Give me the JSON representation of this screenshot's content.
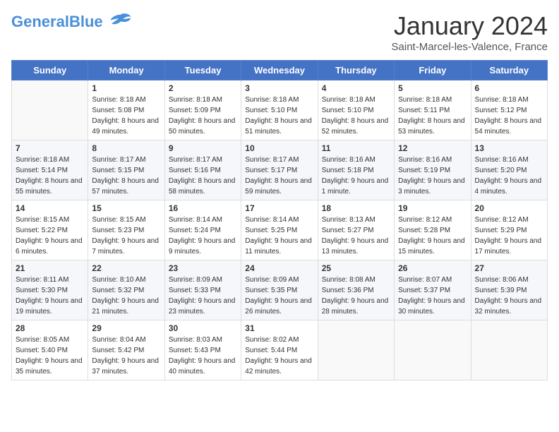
{
  "header": {
    "logo_line1": "General",
    "logo_line2": "Blue",
    "month_title": "January 2024",
    "location": "Saint-Marcel-les-Valence, France"
  },
  "weekdays": [
    "Sunday",
    "Monday",
    "Tuesday",
    "Wednesday",
    "Thursday",
    "Friday",
    "Saturday"
  ],
  "weeks": [
    [
      {
        "day": "",
        "sunrise": "",
        "sunset": "",
        "daylight": ""
      },
      {
        "day": "1",
        "sunrise": "Sunrise: 8:18 AM",
        "sunset": "Sunset: 5:08 PM",
        "daylight": "Daylight: 8 hours and 49 minutes."
      },
      {
        "day": "2",
        "sunrise": "Sunrise: 8:18 AM",
        "sunset": "Sunset: 5:09 PM",
        "daylight": "Daylight: 8 hours and 50 minutes."
      },
      {
        "day": "3",
        "sunrise": "Sunrise: 8:18 AM",
        "sunset": "Sunset: 5:10 PM",
        "daylight": "Daylight: 8 hours and 51 minutes."
      },
      {
        "day": "4",
        "sunrise": "Sunrise: 8:18 AM",
        "sunset": "Sunset: 5:10 PM",
        "daylight": "Daylight: 8 hours and 52 minutes."
      },
      {
        "day": "5",
        "sunrise": "Sunrise: 8:18 AM",
        "sunset": "Sunset: 5:11 PM",
        "daylight": "Daylight: 8 hours and 53 minutes."
      },
      {
        "day": "6",
        "sunrise": "Sunrise: 8:18 AM",
        "sunset": "Sunset: 5:12 PM",
        "daylight": "Daylight: 8 hours and 54 minutes."
      }
    ],
    [
      {
        "day": "7",
        "sunrise": "Sunrise: 8:18 AM",
        "sunset": "Sunset: 5:14 PM",
        "daylight": "Daylight: 8 hours and 55 minutes."
      },
      {
        "day": "8",
        "sunrise": "Sunrise: 8:17 AM",
        "sunset": "Sunset: 5:15 PM",
        "daylight": "Daylight: 8 hours and 57 minutes."
      },
      {
        "day": "9",
        "sunrise": "Sunrise: 8:17 AM",
        "sunset": "Sunset: 5:16 PM",
        "daylight": "Daylight: 8 hours and 58 minutes."
      },
      {
        "day": "10",
        "sunrise": "Sunrise: 8:17 AM",
        "sunset": "Sunset: 5:17 PM",
        "daylight": "Daylight: 8 hours and 59 minutes."
      },
      {
        "day": "11",
        "sunrise": "Sunrise: 8:16 AM",
        "sunset": "Sunset: 5:18 PM",
        "daylight": "Daylight: 9 hours and 1 minute."
      },
      {
        "day": "12",
        "sunrise": "Sunrise: 8:16 AM",
        "sunset": "Sunset: 5:19 PM",
        "daylight": "Daylight: 9 hours and 3 minutes."
      },
      {
        "day": "13",
        "sunrise": "Sunrise: 8:16 AM",
        "sunset": "Sunset: 5:20 PM",
        "daylight": "Daylight: 9 hours and 4 minutes."
      }
    ],
    [
      {
        "day": "14",
        "sunrise": "Sunrise: 8:15 AM",
        "sunset": "Sunset: 5:22 PM",
        "daylight": "Daylight: 9 hours and 6 minutes."
      },
      {
        "day": "15",
        "sunrise": "Sunrise: 8:15 AM",
        "sunset": "Sunset: 5:23 PM",
        "daylight": "Daylight: 9 hours and 7 minutes."
      },
      {
        "day": "16",
        "sunrise": "Sunrise: 8:14 AM",
        "sunset": "Sunset: 5:24 PM",
        "daylight": "Daylight: 9 hours and 9 minutes."
      },
      {
        "day": "17",
        "sunrise": "Sunrise: 8:14 AM",
        "sunset": "Sunset: 5:25 PM",
        "daylight": "Daylight: 9 hours and 11 minutes."
      },
      {
        "day": "18",
        "sunrise": "Sunrise: 8:13 AM",
        "sunset": "Sunset: 5:27 PM",
        "daylight": "Daylight: 9 hours and 13 minutes."
      },
      {
        "day": "19",
        "sunrise": "Sunrise: 8:12 AM",
        "sunset": "Sunset: 5:28 PM",
        "daylight": "Daylight: 9 hours and 15 minutes."
      },
      {
        "day": "20",
        "sunrise": "Sunrise: 8:12 AM",
        "sunset": "Sunset: 5:29 PM",
        "daylight": "Daylight: 9 hours and 17 minutes."
      }
    ],
    [
      {
        "day": "21",
        "sunrise": "Sunrise: 8:11 AM",
        "sunset": "Sunset: 5:30 PM",
        "daylight": "Daylight: 9 hours and 19 minutes."
      },
      {
        "day": "22",
        "sunrise": "Sunrise: 8:10 AM",
        "sunset": "Sunset: 5:32 PM",
        "daylight": "Daylight: 9 hours and 21 minutes."
      },
      {
        "day": "23",
        "sunrise": "Sunrise: 8:09 AM",
        "sunset": "Sunset: 5:33 PM",
        "daylight": "Daylight: 9 hours and 23 minutes."
      },
      {
        "day": "24",
        "sunrise": "Sunrise: 8:09 AM",
        "sunset": "Sunset: 5:35 PM",
        "daylight": "Daylight: 9 hours and 26 minutes."
      },
      {
        "day": "25",
        "sunrise": "Sunrise: 8:08 AM",
        "sunset": "Sunset: 5:36 PM",
        "daylight": "Daylight: 9 hours and 28 minutes."
      },
      {
        "day": "26",
        "sunrise": "Sunrise: 8:07 AM",
        "sunset": "Sunset: 5:37 PM",
        "daylight": "Daylight: 9 hours and 30 minutes."
      },
      {
        "day": "27",
        "sunrise": "Sunrise: 8:06 AM",
        "sunset": "Sunset: 5:39 PM",
        "daylight": "Daylight: 9 hours and 32 minutes."
      }
    ],
    [
      {
        "day": "28",
        "sunrise": "Sunrise: 8:05 AM",
        "sunset": "Sunset: 5:40 PM",
        "daylight": "Daylight: 9 hours and 35 minutes."
      },
      {
        "day": "29",
        "sunrise": "Sunrise: 8:04 AM",
        "sunset": "Sunset: 5:42 PM",
        "daylight": "Daylight: 9 hours and 37 minutes."
      },
      {
        "day": "30",
        "sunrise": "Sunrise: 8:03 AM",
        "sunset": "Sunset: 5:43 PM",
        "daylight": "Daylight: 9 hours and 40 minutes."
      },
      {
        "day": "31",
        "sunrise": "Sunrise: 8:02 AM",
        "sunset": "Sunset: 5:44 PM",
        "daylight": "Daylight: 9 hours and 42 minutes."
      },
      {
        "day": "",
        "sunrise": "",
        "sunset": "",
        "daylight": ""
      },
      {
        "day": "",
        "sunrise": "",
        "sunset": "",
        "daylight": ""
      },
      {
        "day": "",
        "sunrise": "",
        "sunset": "",
        "daylight": ""
      }
    ]
  ]
}
